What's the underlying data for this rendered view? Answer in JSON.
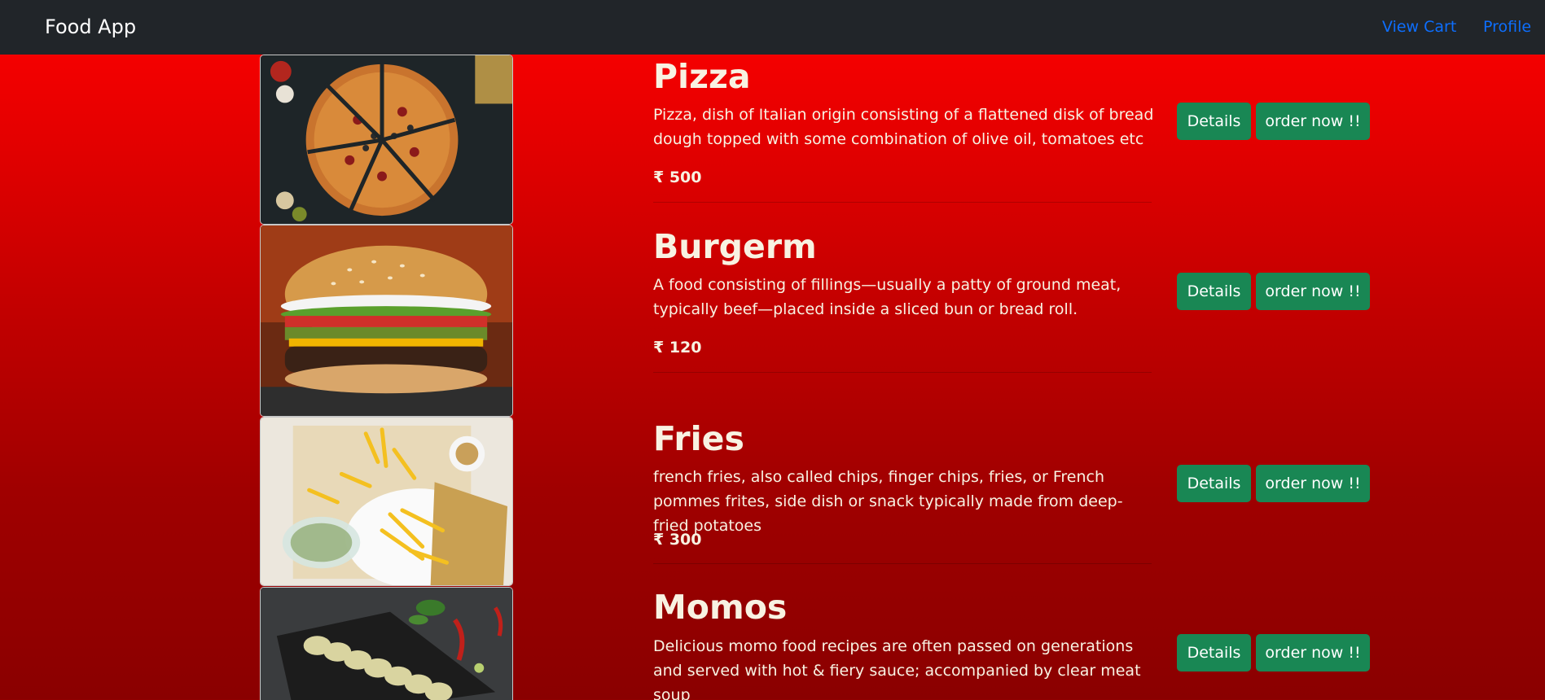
{
  "navbar": {
    "brand": "Food App",
    "links": [
      "View Cart",
      "Profile"
    ]
  },
  "items": [
    {
      "name": "Pizza",
      "description": "Pizza, dish of Italian origin consisting of a flattened disk of bread dough topped with some combination of olive oil, tomatoes etc",
      "price": "₹ 500",
      "image": "pizza-photo",
      "details_label": "Details",
      "order_label": "order now !!"
    },
    {
      "name": "Burgerm",
      "description": "A food consisting of fillings—usually a patty of ground meat, typically beef—placed inside a sliced bun or bread roll.",
      "price": "₹ 120",
      "image": "burger-photo",
      "details_label": "Details",
      "order_label": "order now !!"
    },
    {
      "name": "Fries",
      "description": "french fries, also called chips, finger chips, fries, or French pommes frites, side dish or snack typically made from deep-fried potatoes",
      "price": "₹ 300",
      "image": "fries-photo",
      "details_label": "Details",
      "order_label": "order now !!"
    },
    {
      "name": "Momos",
      "description": "Delicious momo food recipes are often passed on generations and served with hot & fiery sauce; accompanied by clear meat soup",
      "price": "",
      "image": "momos-photo",
      "details_label": "Details",
      "order_label": "order now !!"
    }
  ],
  "colors": {
    "navbar_bg": "#212529",
    "link": "#0d6efd",
    "button": "#198754",
    "text": "#f8f2e2",
    "gradient_top": "#ff0000",
    "gradient_bottom": "#8a0000"
  }
}
